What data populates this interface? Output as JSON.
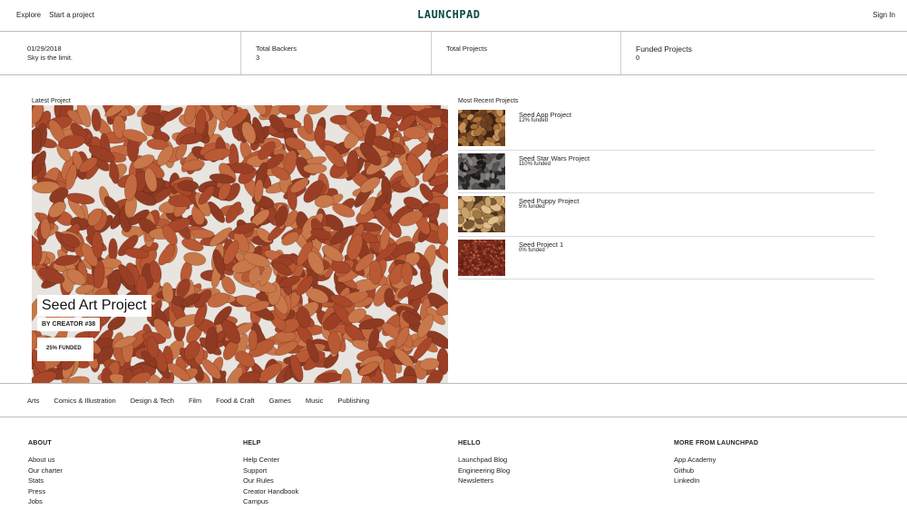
{
  "header": {
    "nav": [
      "Explore",
      "Start a project"
    ],
    "logo": "LAUNCHPAD",
    "sign_in": "Sign In"
  },
  "stats": {
    "date": "01/29/2018",
    "tagline": "Sky is the limit.",
    "backers_label": "Total Backers",
    "backers_value": "3",
    "projects_label": "Total Projects",
    "funded_label": "Funded Projects",
    "funded_value": "0"
  },
  "latest": {
    "label": "Latest Project",
    "title": "Seed Art Project",
    "creator": "BY CREATOR #38",
    "funded": "25% FUNDED"
  },
  "recent": {
    "label": "Most Recent Projects",
    "items": [
      {
        "name": "Seed App Project",
        "funded": "12% funded"
      },
      {
        "name": "Seed Star Wars Project",
        "funded": "110% funded"
      },
      {
        "name": "Seed Puppy Project",
        "funded": "5% funded"
      },
      {
        "name": "Seed Project 1",
        "funded": "0% funded"
      }
    ]
  },
  "categories": [
    "Arts",
    "Comics & Illustration",
    "Design & Tech",
    "Film",
    "Food & Craft",
    "Games",
    "Music",
    "Publishing"
  ],
  "footer": {
    "about": {
      "title": "ABOUT",
      "links": [
        "About us",
        "Our charter",
        "Stats",
        "Press",
        "Jobs"
      ]
    },
    "help": {
      "title": "HELP",
      "links": [
        "Help Center",
        "Support",
        "Our Rules",
        "Creator Handbook",
        "Campus"
      ]
    },
    "hello": {
      "title": "HELLO",
      "links": [
        "Launchpad Blog",
        "Engineering Blog",
        "Newsletters"
      ]
    },
    "more": {
      "title": "MORE FROM LAUNCHPAD",
      "links": [
        "App Academy",
        "Github",
        "LinkedIn"
      ]
    }
  },
  "colors": {
    "logo": "#0e4a4a",
    "border": "#bdbdbd",
    "seed_brown": "#b4552f"
  }
}
